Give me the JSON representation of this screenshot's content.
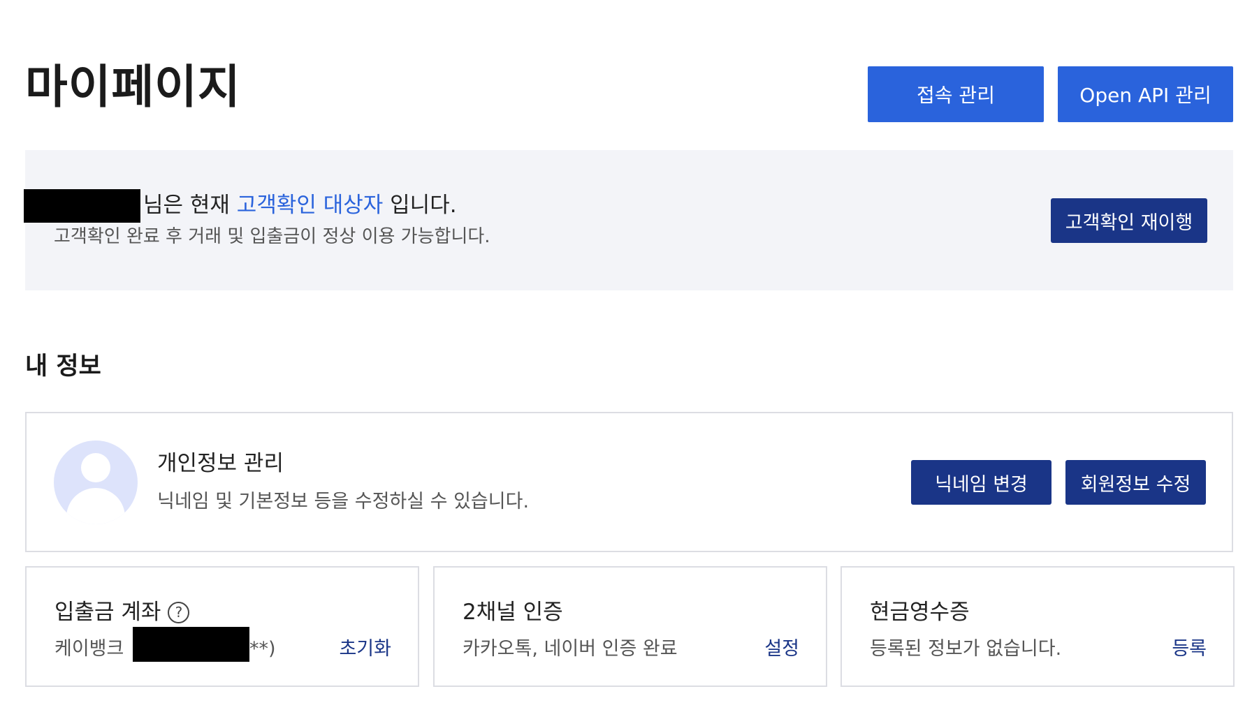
{
  "page": {
    "title": "마이페이지"
  },
  "header_buttons": {
    "access": "접속 관리",
    "open_api": "Open API 관리"
  },
  "kyc": {
    "line1_suffix_before": "님은 현재 ",
    "highlight": "고객확인 대상자",
    "line1_suffix_after": " 입니다.",
    "line2": "고객확인 완료 후 거래 및 입출금이 정상 이용 가능합니다.",
    "button": "고객확인 재이행"
  },
  "section": {
    "title": "내 정보"
  },
  "profile": {
    "title": "개인정보 관리",
    "desc": "닉네임 및 기본정보 등을 수정하실 수 있습니다.",
    "btn_nickname": "닉네임 변경",
    "btn_member": "회원정보 수정"
  },
  "account": {
    "title": "입출금 계좌",
    "help": "?",
    "bank": "케이뱅크",
    "suffix": "**)",
    "action": "초기화"
  },
  "two_factor": {
    "title": "2채널 인증",
    "desc": "카카오톡, 네이버 인증 완료",
    "action": "설정"
  },
  "receipt": {
    "title": "현금영수증",
    "desc": "등록된 정보가 없습니다.",
    "action": "등록"
  },
  "colors": {
    "primary": "#2a63dc",
    "dark_button": "#1a3587",
    "panel_bg": "#f3f4f8",
    "avatar_bg": "#dde3fb"
  }
}
